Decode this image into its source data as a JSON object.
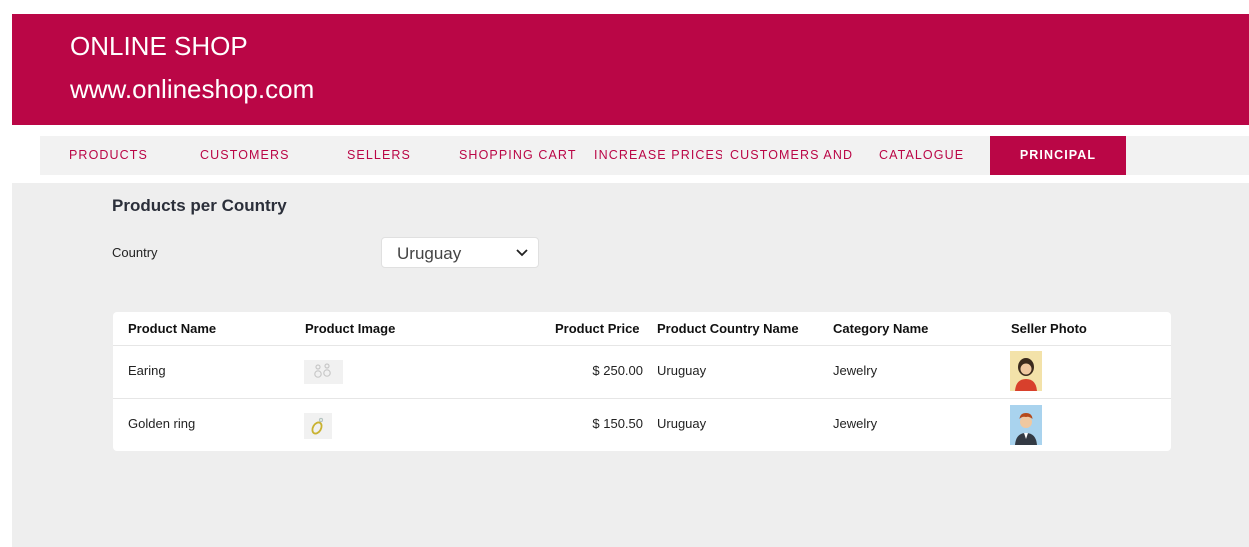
{
  "header": {
    "title": "ONLINE SHOP",
    "url": "www.onlineshop.com"
  },
  "nav": {
    "items": [
      "PRODUCTS",
      "CUSTOMERS",
      "SELLERS",
      "SHOPPING CART",
      "INCREASE PRICES",
      "CUSTOMERS AND",
      "CATALOGUE",
      "PRINCIPAL"
    ],
    "active": "PRINCIPAL"
  },
  "page": {
    "heading": "Products per Country",
    "filter_label": "Country",
    "country_value": "Uruguay"
  },
  "table": {
    "headers": [
      "Product Name",
      "Product Image",
      "Product Price",
      "Product Country Name",
      "Category Name",
      "Seller Photo"
    ],
    "rows": [
      {
        "name": "Earing",
        "image_icon": "earring-image-icon",
        "price": "$ 250.00",
        "country": "Uruguay",
        "category": "Jewelry",
        "seller_icon": "female-seller-avatar-icon"
      },
      {
        "name": "Golden ring",
        "image_icon": "ring-image-icon",
        "price": "$ 150.50",
        "country": "Uruguay",
        "category": "Jewelry",
        "seller_icon": "male-seller-avatar-icon"
      }
    ]
  },
  "colors": {
    "brand": "#ba0646",
    "nav_bg": "#f2f2f2",
    "page_bg": "#eeeeee"
  }
}
